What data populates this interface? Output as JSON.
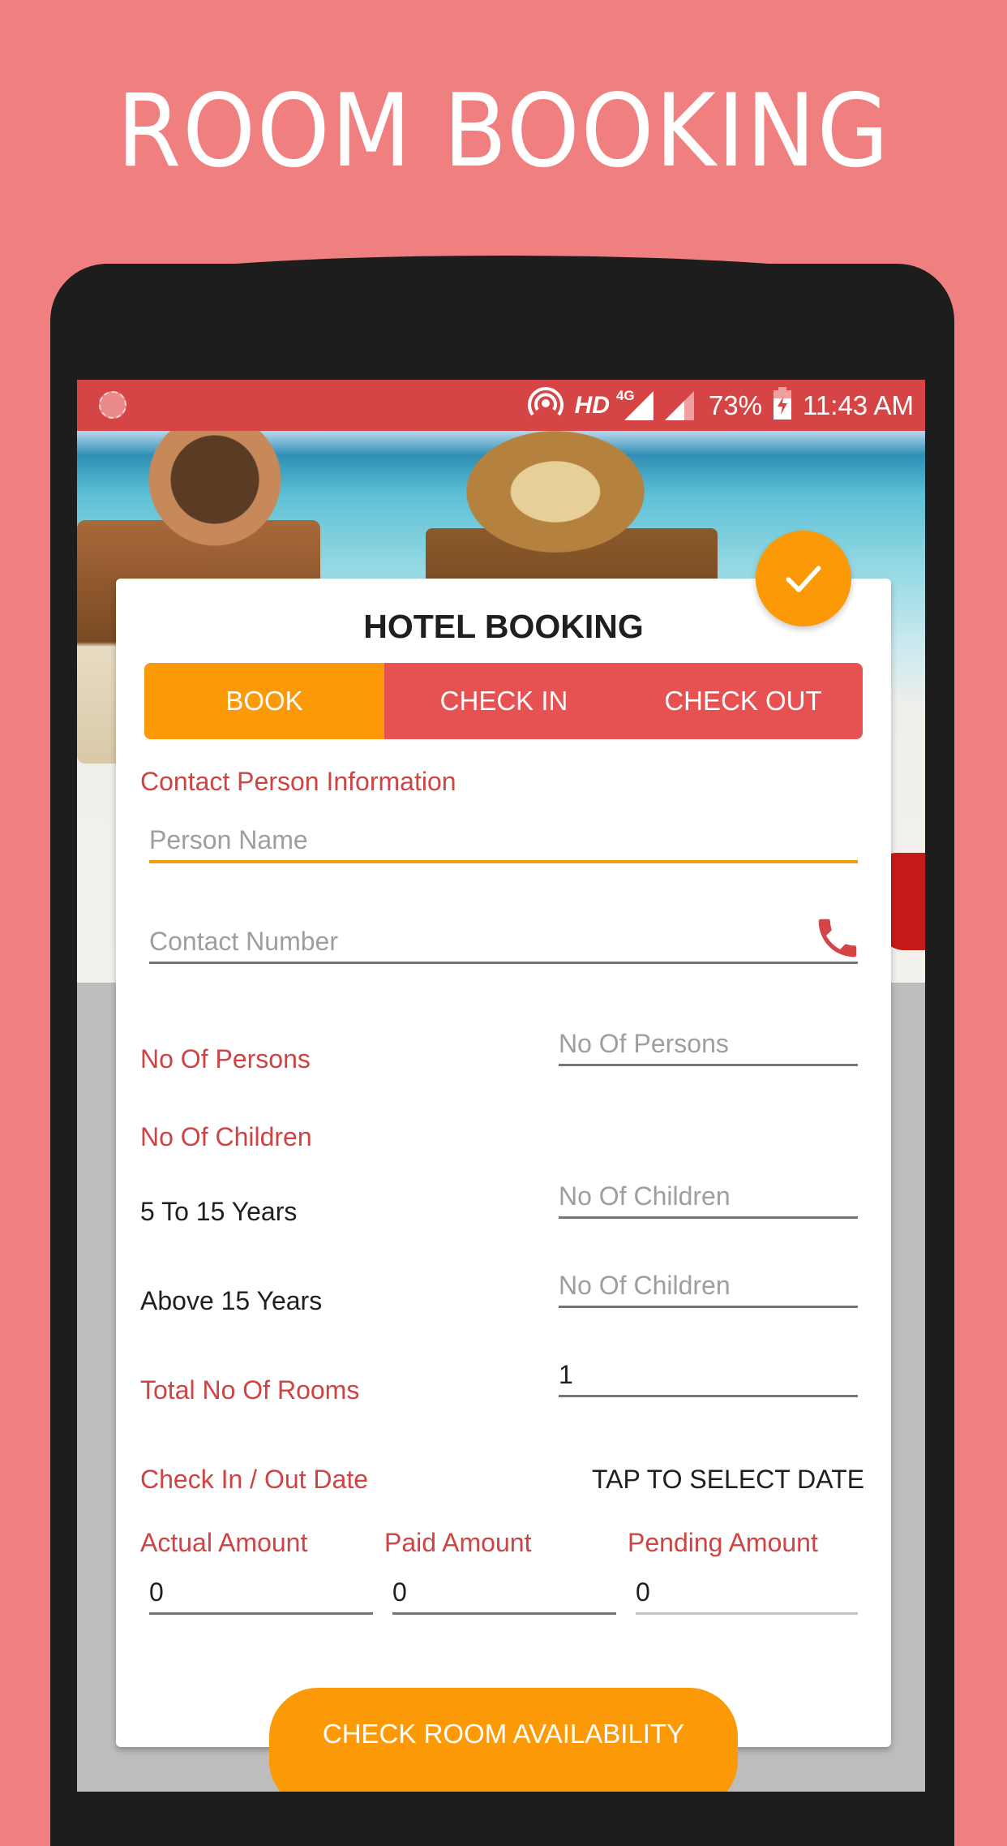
{
  "promo": {
    "title": "ROOM BOOKING",
    "background_color": "#f08080"
  },
  "status_bar": {
    "left_icon": "loading-spinner-icon",
    "hd_label": "HD",
    "network_label": "4G",
    "battery_percent": "73%",
    "time": "11:43 AM",
    "background_color": "#d64545"
  },
  "card": {
    "title": "HOTEL BOOKING",
    "fab_icon": "checkmark-icon",
    "tabs": [
      {
        "label": "BOOK",
        "active": true
      },
      {
        "label": "CHECK IN",
        "active": false
      },
      {
        "label": "CHECK OUT",
        "active": false
      }
    ],
    "section_contact": "Contact Person Information",
    "person_name": {
      "placeholder": "Person Name",
      "value": ""
    },
    "contact_number": {
      "placeholder": "Contact Number",
      "value": "",
      "icon": "phone-icon"
    },
    "persons": {
      "label": "No Of Persons",
      "placeholder": "No Of Persons",
      "value": ""
    },
    "children_section": "No Of Children",
    "children_5_15": {
      "label": "5 To 15 Years",
      "placeholder": "No Of Children",
      "value": ""
    },
    "children_above_15": {
      "label": "Above 15 Years",
      "placeholder": "No Of Children",
      "value": ""
    },
    "rooms": {
      "label": "Total No Of Rooms",
      "value": "1"
    },
    "dates": {
      "label": "Check In / Out Date",
      "action": "TAP TO SELECT DATE"
    },
    "amounts": {
      "actual": {
        "label": "Actual Amount",
        "value": "0"
      },
      "paid": {
        "label": "Paid Amount",
        "value": "0"
      },
      "pending": {
        "label": "Pending Amount",
        "value": "0"
      }
    },
    "cta_label": "CHECK ROOM AVAILABILITY"
  },
  "colors": {
    "accent_orange": "#fb9a06",
    "tab_red": "#e85151",
    "label_red": "#cf4343"
  }
}
